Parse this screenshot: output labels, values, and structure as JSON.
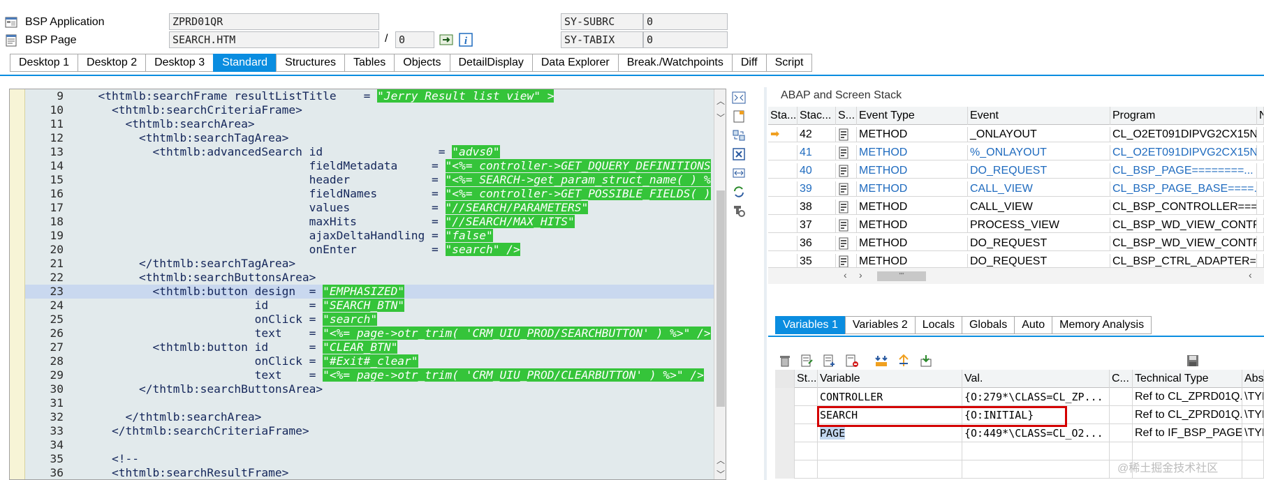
{
  "header": {
    "bsp_app_label": "BSP Application",
    "bsp_app_value": "ZPRD01QR",
    "bsp_page_label": "BSP Page",
    "bsp_page_value": "SEARCH.HTM",
    "page_slash": "/",
    "page_num": "0",
    "sy_subrc_label": "SY-SUBRC",
    "sy_subrc_value": "0",
    "sy_tabix_label": "SY-TABIX",
    "sy_tabix_value": "0"
  },
  "tabs": [
    "Desktop 1",
    "Desktop 2",
    "Desktop 3",
    "Standard",
    "Structures",
    "Tables",
    "Objects",
    "DetailDisplay",
    "Data Explorer",
    "Break./Watchpoints",
    "Diff",
    "Script"
  ],
  "active_tab": "Standard",
  "code": {
    "current_line": "23",
    "lines": [
      {
        "n": "9",
        "pre": "  <thtmlb:searchFrame resultListTitle    = ",
        "str": "\"Jerry Result list view\" >",
        "post": ""
      },
      {
        "n": "10",
        "pre": "    <thtmlb:searchCriteriaFrame>",
        "str": "",
        "post": ""
      },
      {
        "n": "11",
        "pre": "      <thtmlb:searchArea>",
        "str": "",
        "post": ""
      },
      {
        "n": "12",
        "pre": "        <thtmlb:searchTagArea>",
        "str": "",
        "post": ""
      },
      {
        "n": "13",
        "pre": "          <thtmlb:advancedSearch id                 = ",
        "str": "\"advs0\"",
        "post": ""
      },
      {
        "n": "14",
        "pre": "                                 fieldMetadata     = ",
        "str": "\"<%= controller->GET_DQUERY_DEFINITIONS",
        "post": ""
      },
      {
        "n": "15",
        "pre": "                                 header            = ",
        "str": "\"<%= SEARCH->get_param_struct_name( ) %",
        "post": ""
      },
      {
        "n": "16",
        "pre": "                                 fieldNames        = ",
        "str": "\"<%= controller->GET_POSSIBLE_FIELDS( )",
        "post": ""
      },
      {
        "n": "17",
        "pre": "                                 values            = ",
        "str": "\"//SEARCH/PARAMETERS\"",
        "post": ""
      },
      {
        "n": "18",
        "pre": "                                 maxHits           = ",
        "str": "\"//SEARCH/MAX_HITS\"",
        "post": ""
      },
      {
        "n": "19",
        "pre": "                                 ajaxDeltaHandling = ",
        "str": "\"false\"",
        "post": ""
      },
      {
        "n": "20",
        "pre": "                                 onEnter           = ",
        "str": "\"search\" />",
        "post": ""
      },
      {
        "n": "21",
        "pre": "        </thtmlb:searchTagArea>",
        "str": "",
        "post": ""
      },
      {
        "n": "22",
        "pre": "        <thtmlb:searchButtonsArea>",
        "str": "",
        "post": ""
      },
      {
        "n": "23",
        "pre": "          <thtmlb:button design  = ",
        "str": "\"EMPHASIZED\"",
        "post": ""
      },
      {
        "n": "24",
        "pre": "                         id      = ",
        "str": "\"SEARCH_BTN\"",
        "post": ""
      },
      {
        "n": "25",
        "pre": "                         onClick = ",
        "str": "\"search\"",
        "post": ""
      },
      {
        "n": "26",
        "pre": "                         text    = ",
        "str": "\"<%= page->otr_trim( 'CRM_UIU_PROD/SEARCHBUTTON' ) %>\" />",
        "post": ""
      },
      {
        "n": "27",
        "pre": "          <thtmlb:button id      = ",
        "str": "\"CLEAR_BTN\"",
        "post": ""
      },
      {
        "n": "28",
        "pre": "                         onClick = ",
        "str": "\"#Exit#_clear\"",
        "post": ""
      },
      {
        "n": "29",
        "pre": "                         text    = ",
        "str": "\"<%= page->otr_trim( 'CRM_UIU_PROD/CLEARBUTTON' ) %>\" />",
        "post": ""
      },
      {
        "n": "30",
        "pre": "        </thtmlb:searchButtonsArea>",
        "str": "",
        "post": ""
      },
      {
        "n": "31",
        "pre": "",
        "str": "",
        "post": ""
      },
      {
        "n": "32",
        "pre": "      </thtmlb:searchArea>",
        "str": "",
        "post": ""
      },
      {
        "n": "33",
        "pre": "    </thtmlb:searchCriteriaFrame>",
        "str": "",
        "post": ""
      },
      {
        "n": "34",
        "pre": "",
        "str": "",
        "post": ""
      },
      {
        "n": "35",
        "pre": "    <!--",
        "str": "",
        "post": ""
      },
      {
        "n": "36",
        "pre": "    <thtmlb:searchResultFrame>",
        "str": "",
        "post": ""
      }
    ]
  },
  "stack": {
    "title": "ABAP and Screen Stack",
    "columns": [
      "Sta...",
      "Stac...",
      "S...",
      "Event Type",
      "Event",
      "Program",
      "N"
    ],
    "rows": [
      {
        "marker": "➡",
        "level": "42",
        "type": "METHOD",
        "event": "_ONLAYOUT",
        "program": "CL_O2ET091DIPVG2CX15N...",
        "blue": false
      },
      {
        "marker": "",
        "level": "41",
        "type": "METHOD",
        "event": "%_ONLAYOUT",
        "program": "CL_O2ET091DIPVG2CX15N...",
        "blue": true
      },
      {
        "marker": "",
        "level": "40",
        "type": "METHOD",
        "event": "DO_REQUEST",
        "program": "CL_BSP_PAGE========...",
        "blue": true
      },
      {
        "marker": "",
        "level": "39",
        "type": "METHOD",
        "event": "CALL_VIEW",
        "program": "CL_BSP_PAGE_BASE====...",
        "blue": true
      },
      {
        "marker": "",
        "level": "38",
        "type": "METHOD",
        "event": "CALL_VIEW",
        "program": "CL_BSP_CONTROLLER===...",
        "blue": false
      },
      {
        "marker": "",
        "level": "37",
        "type": "METHOD",
        "event": "PROCESS_VIEW",
        "program": "CL_BSP_WD_VIEW_CONTR...",
        "blue": false
      },
      {
        "marker": "",
        "level": "36",
        "type": "METHOD",
        "event": "DO_REQUEST",
        "program": "CL_BSP_WD_VIEW_CONTR...",
        "blue": false
      },
      {
        "marker": "",
        "level": "35",
        "type": "METHOD",
        "event": "DO_REQUEST",
        "program": "CL_BSP_CTRL_ADAPTER=...",
        "blue": false
      }
    ],
    "scroll_mid": "\"\""
  },
  "var_tabs": [
    "Variables 1",
    "Variables 2",
    "Locals",
    "Globals",
    "Auto",
    "Memory Analysis"
  ],
  "active_var_tab": "Variables 1",
  "vars": {
    "columns": [
      "St...",
      "Variable",
      "Val.",
      "C...",
      "Technical Type",
      "Abs"
    ],
    "rows": [
      {
        "variable": "CONTROLLER",
        "value": "{O:279*\\CLASS=CL_ZP...",
        "ttype": "Ref to CL_ZPRD01Q...",
        "abs": "\\TYP"
      },
      {
        "variable": "SEARCH",
        "value": "{O:INITIAL}",
        "ttype": "Ref to CL_ZPRD01Q...",
        "abs": "\\TYP"
      },
      {
        "variable": "PAGE",
        "value": "{O:449*\\CLASS=CL_O2...",
        "ttype": "Ref to IF_BSP_PAGE",
        "abs": "\\TYP"
      }
    ]
  },
  "watermark": "@稀土掘金技术社区"
}
